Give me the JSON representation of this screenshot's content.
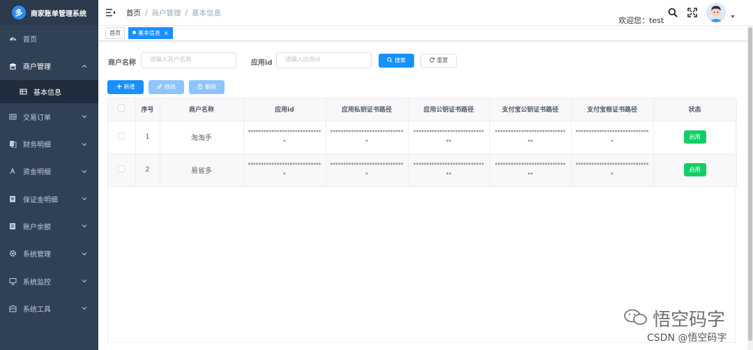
{
  "app": {
    "title": "商家账单管理系统",
    "logo_letter": "多"
  },
  "sidebar": {
    "items": [
      {
        "label": "首页",
        "icon": "dashboard-icon"
      },
      {
        "label": "商户管理",
        "icon": "merchant-icon",
        "expanded": true
      },
      {
        "label": "基本信息",
        "icon": "table-icon",
        "sub": true,
        "active": true
      },
      {
        "label": "交易订单",
        "icon": "grid-icon"
      },
      {
        "label": "财务明细",
        "icon": "documents-icon"
      },
      {
        "label": "资金明细",
        "icon": "money-icon"
      },
      {
        "label": "保证金明细",
        "icon": "form-icon"
      },
      {
        "label": "账户余额",
        "icon": "wallet-icon"
      },
      {
        "label": "系统管理",
        "icon": "gear-icon"
      },
      {
        "label": "系统监控",
        "icon": "monitor-icon"
      },
      {
        "label": "系统工具",
        "icon": "toolbox-icon"
      }
    ]
  },
  "header": {
    "breadcrumb": [
      "首页",
      "商户管理",
      "基本信息"
    ],
    "welcome": "欢迎您：test"
  },
  "tags": {
    "home": "首页",
    "active": "基本信息",
    "close": "×"
  },
  "search": {
    "merchant_label": "商户名称",
    "merchant_placeholder": "请输入商户名称",
    "appid_label": "应用id",
    "appid_placeholder": "请输入应用id",
    "search_btn": "搜索",
    "reset_btn": "重置"
  },
  "toolbar": {
    "add": "新增",
    "edit": "修改",
    "delete": "删除"
  },
  "table": {
    "columns": [
      "序号",
      "商户名称",
      "应用id",
      "应用私钥证书路径",
      "应用公钥证书路径",
      "支付宝公钥证书路径",
      "支付宝根证书路径",
      "状态"
    ],
    "rows": [
      {
        "index": "1",
        "name": "淘淘手",
        "app_id": "*****************************",
        "app_private_cert": "*****************************",
        "app_public_cert": "*****************************",
        "alipay_public_cert": "*****************************",
        "alipay_root_cert": "*****************************",
        "status": "启用"
      },
      {
        "index": "2",
        "name": "易省多",
        "app_id": "*****************************",
        "app_private_cert": "*****************************",
        "app_public_cert": "*****************************",
        "alipay_public_cert": "*****************************",
        "alipay_root_cert": "*****************************",
        "status": "启用"
      }
    ]
  },
  "watermark": {
    "main": "悟空码字",
    "sub": "CSDN @悟空码字"
  },
  "colors": {
    "sidebar_bg": "#304156",
    "sidebar_active_bg": "#1f2d3d",
    "primary": "#1890ff",
    "success": "#13ce66"
  }
}
